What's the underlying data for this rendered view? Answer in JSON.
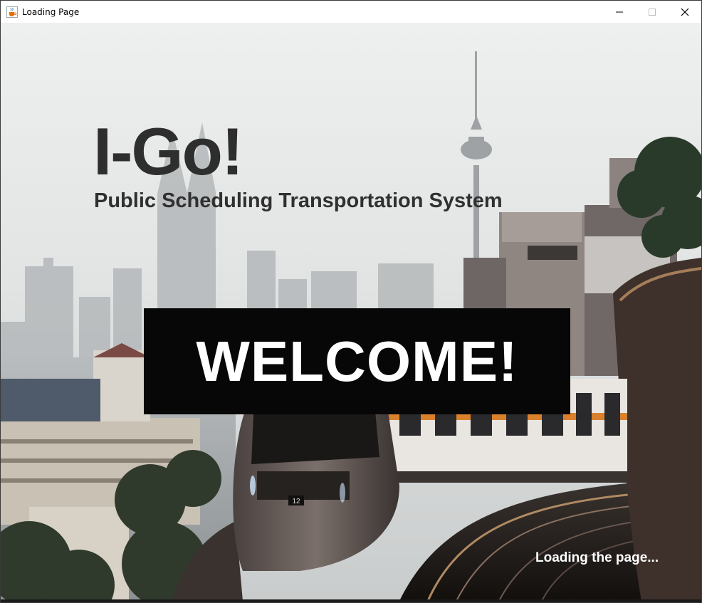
{
  "window": {
    "title": "Loading Page",
    "icon": "java-cup-icon",
    "controls": [
      "minimize-icon",
      "maximize-icon",
      "close-icon"
    ]
  },
  "brand": {
    "title": "I-Go!",
    "subtitle": "Public Scheduling Transportation System"
  },
  "banner": {
    "text": "WELCOME!"
  },
  "status": {
    "text": "Loading the page..."
  },
  "train": {
    "number": "12"
  },
  "colors": {
    "banner_bg": "#070707",
    "title_text": "#2e2e2e",
    "sky": "#e4e6e6"
  }
}
